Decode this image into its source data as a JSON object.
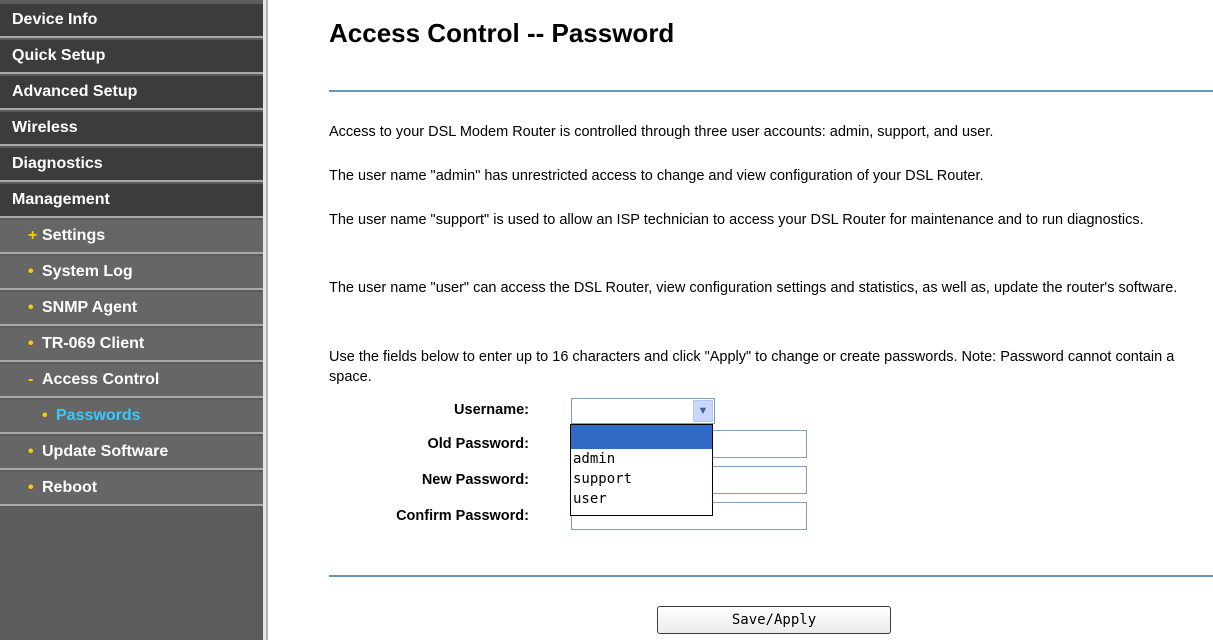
{
  "sidebar": {
    "items": [
      {
        "label": "Device Info"
      },
      {
        "label": "Quick Setup"
      },
      {
        "label": "Advanced Setup"
      },
      {
        "label": "Wireless"
      },
      {
        "label": "Diagnostics"
      },
      {
        "label": "Management"
      },
      {
        "label": "Settings",
        "bullet": "+"
      },
      {
        "label": "System Log",
        "bullet": "•"
      },
      {
        "label": "SNMP Agent",
        "bullet": "•"
      },
      {
        "label": "TR-069 Client",
        "bullet": "•"
      },
      {
        "label": "Access Control",
        "bullet": "-"
      },
      {
        "label": "Passwords",
        "bullet": "•"
      },
      {
        "label": "Update Software",
        "bullet": "•"
      },
      {
        "label": "Reboot",
        "bullet": "•"
      }
    ]
  },
  "main": {
    "title": "Access Control -- Password",
    "paragraphs": [
      "Access to your DSL Modem Router is controlled through three user accounts: admin, support, and user.",
      "The user name \"admin\" has unrestricted access to change and view configuration of your DSL Router.",
      "The user name \"support\" is used to allow an ISP technician to access your DSL Router for maintenance and to run diagnostics.",
      "The user name \"user\" can access the DSL Router, view configuration settings and statistics, as well as, update the router's software.",
      "Use the fields below to enter up to 16 characters and click \"Apply\" to change or create passwords. Note: Password cannot contain a space."
    ],
    "form": {
      "username_label": "Username:",
      "old_password_label": "Old Password:",
      "new_password_label": "New Password:",
      "confirm_password_label": "Confirm Password:",
      "username_value": "",
      "username_options": [
        "",
        "admin",
        "support",
        "user"
      ]
    },
    "save_button": "Save/Apply"
  },
  "colors": {
    "sidebar_bg": "#3c3c3c",
    "active_item": "#33ccff",
    "bullet": "#ffcc00",
    "rule": "#6b93b5",
    "dropdown_highlight": "#316ac5"
  },
  "icons": {
    "select_arrow": "chevron-down-icon"
  }
}
